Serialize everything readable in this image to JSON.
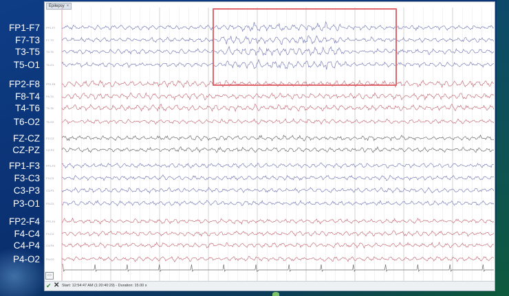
{
  "window": {
    "tab_label": "Epilepsy",
    "tab_close": "×"
  },
  "channel_labels": [
    "FP1-F7",
    "F7-T3",
    "T3-T5",
    "T5-O1",
    "FP2-F8",
    "F8-T4",
    "T4-T6",
    "T6-O2",
    "FZ-CZ",
    "CZ-PZ",
    "FP1-F3",
    "F3-C3",
    "C3-P3",
    "P3-O1",
    "FP2-F4",
    "F4-C4",
    "C4-P4",
    "P4-O2"
  ],
  "trace_colors": {
    "left_temporal": "#7b7fb8",
    "right_temporal": "#c7707a",
    "midline": "#6b6b6b",
    "left_parasagittal": "#7b7fb8",
    "right_parasagittal": "#c7707a",
    "ekg": "#6b6b6b"
  },
  "highlight_color": "#e0656c",
  "status_bar": {
    "accept_icon": "checkmark-icon",
    "reject_icon": "close-icon",
    "text": "Start: 12:54:47 AM (1:20:40:29) - Duration: 15.00 s"
  }
}
